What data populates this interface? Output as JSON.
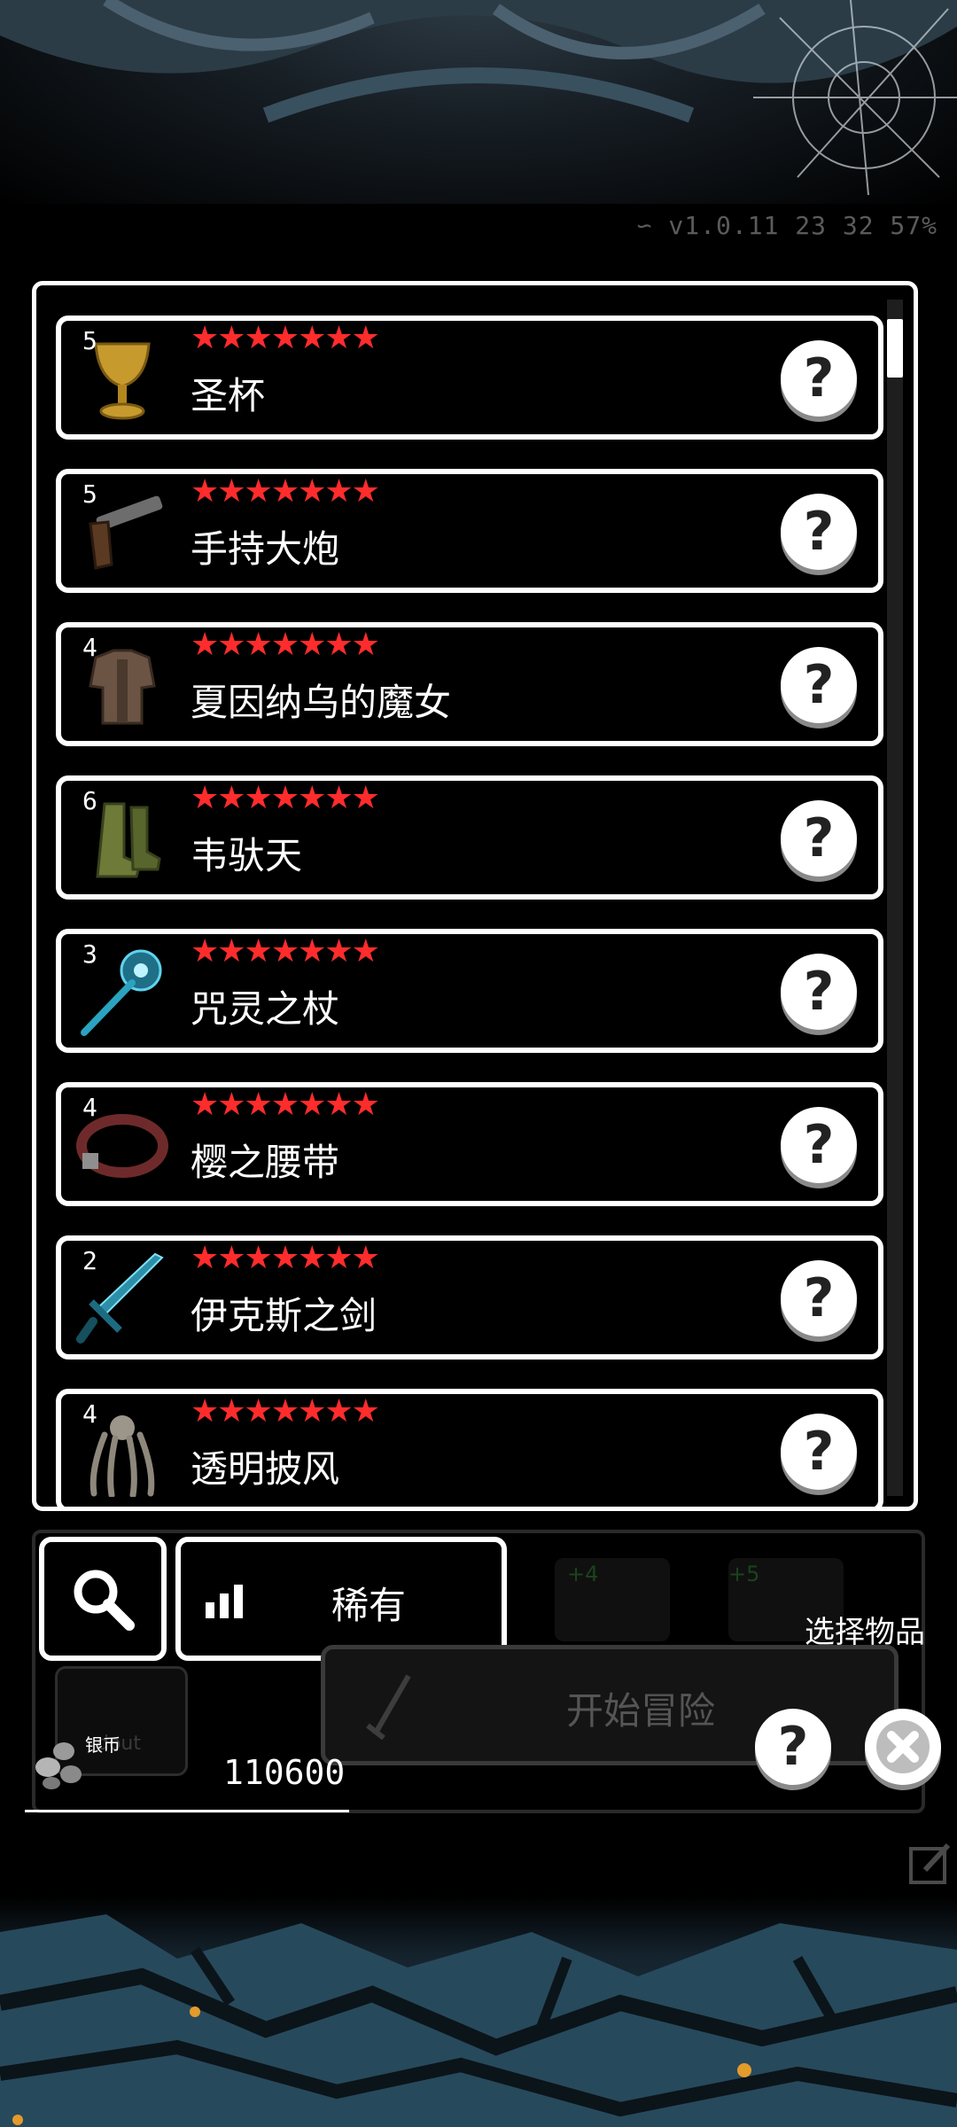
{
  "status_bar": {
    "text": "∽ v1.0.11  23 32 57%"
  },
  "items": [
    {
      "count": "5",
      "stars": "★★★★★★★",
      "name": "圣杯",
      "icon": "goblet-icon"
    },
    {
      "count": "5",
      "stars": "★★★★★★★",
      "name": "手持大炮",
      "icon": "pistol-icon"
    },
    {
      "count": "4",
      "stars": "★★★★★★★",
      "name": "夏因纳乌的魔女",
      "icon": "armor-icon"
    },
    {
      "count": "6",
      "stars": "★★★★★★★",
      "name": "韦驮天",
      "icon": "boots-icon"
    },
    {
      "count": "3",
      "stars": "★★★★★★★",
      "name": "咒灵之杖",
      "icon": "staff-icon"
    },
    {
      "count": "4",
      "stars": "★★★★★★★",
      "name": "樱之腰带",
      "icon": "belt-icon"
    },
    {
      "count": "2",
      "stars": "★★★★★★★",
      "name": "伊克斯之剑",
      "icon": "sword-icon"
    },
    {
      "count": "4",
      "stars": "★★★★★★★",
      "name": "透明披风",
      "icon": "cloak-icon"
    }
  ],
  "help_glyph": "?",
  "filter": {
    "rarity_label": "稀有"
  },
  "bottom": {
    "select_label": "选择物品",
    "start_label": "开始冒险",
    "loadout_label": "dout",
    "coin_label": "银币",
    "coin_value": "110600",
    "slot_plus_a": "+4",
    "slot_plus_b": "+5"
  },
  "colors": {
    "star": "#ff2c2c",
    "border": "#ffffff",
    "background": "#000000"
  }
}
